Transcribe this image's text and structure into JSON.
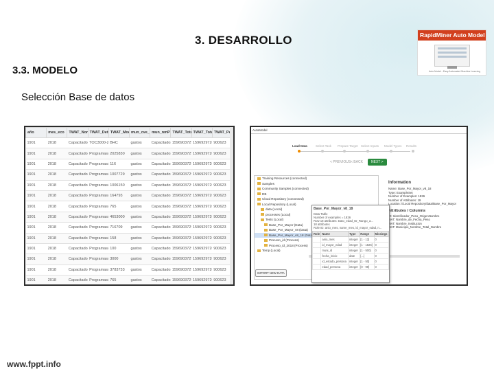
{
  "slide": {
    "title": "3. DESARROLLO",
    "subtitle": "3.3. MODELO",
    "caption": "Selección Base de datos",
    "footer": "www.fppt.info"
  },
  "logo": {
    "title": "RapidMiner Auto Model",
    "tagline": "Auto Model - Easy Automated Machine Learning"
  },
  "table_shot": {
    "columns": [
      "año",
      "mes_eco",
      "TWAT_Nombr...",
      "TWAT_Detalle",
      "TWAT_Mode",
      "mun_cve_Pl...",
      "mun_nmPlu...",
      "TWAT_Total...",
      "TWAT_Total...",
      "TWAT_Peros..."
    ],
    "rows": [
      [
        "1901",
        "2018",
        "Capacitados",
        "TOC3000-20...",
        "BHC",
        "gastos",
        "Capacitados",
        "1596903729",
        "1596929726",
        "900623"
      ],
      [
        "1901",
        "2018",
        "Capacitados",
        "Programas/t...",
        "2025830",
        "gastos",
        "Capacitados",
        "1596903729",
        "1596929726",
        "900623"
      ],
      [
        "1901",
        "2018",
        "Capacitados",
        "Programas/t...",
        "116",
        "gastos",
        "Capacitados",
        "1596903729",
        "1596929726",
        "900623"
      ],
      [
        "1901",
        "2018",
        "Capacitados",
        "Programas/t...",
        "1007729",
        "gastos",
        "Capacitados",
        "1596903729",
        "1596929726",
        "900623"
      ],
      [
        "1901",
        "2018",
        "Capacitados",
        "Programas/t...",
        "1006150",
        "gastos",
        "Capacitados",
        "1596903729",
        "1596929726",
        "900623"
      ],
      [
        "1901",
        "2018",
        "Capacitados",
        "Programas/t...",
        "164793",
        "gastos",
        "Capacitados",
        "1596903729",
        "1596929726",
        "900623"
      ],
      [
        "1901",
        "2018",
        "Capacitados",
        "Programas/t...",
        "765",
        "gastos",
        "Capacitados",
        "1596903729",
        "1596929726",
        "900623"
      ],
      [
        "1901",
        "2018",
        "Capacitados",
        "Programas/t...",
        "4653000",
        "gastos",
        "Capacitados",
        "1596903729",
        "1596929726",
        "900623"
      ],
      [
        "1901",
        "2018",
        "Capacitados",
        "Programas/t...",
        "716709",
        "gastos",
        "Capacitados",
        "1596903729",
        "1596929726",
        "900623"
      ],
      [
        "1901",
        "2018",
        "Capacitados",
        "Programas/t...",
        "158",
        "gastos",
        "Capacitados",
        "1596903729",
        "1596929726",
        "900623"
      ],
      [
        "1901",
        "2018",
        "Capacitados",
        "Programas/t...",
        "100",
        "gastos",
        "Capacitados",
        "1596903729",
        "1596929726",
        "900623"
      ],
      [
        "1901",
        "2018",
        "Capacitados",
        "Programas/t...",
        "3000",
        "gastos",
        "Capacitados",
        "1596903729",
        "1596929726",
        "900623"
      ],
      [
        "1901",
        "2018",
        "Capacitados",
        "Programas/t...",
        "3783733",
        "gastos",
        "Capacitados",
        "1596903729",
        "1596929726",
        "900623"
      ],
      [
        "1901",
        "2018",
        "Capacitados",
        "Programas/t...",
        "765",
        "gastos",
        "Capacitados",
        "1596903729",
        "1596929726",
        "900623"
      ]
    ]
  },
  "rm_shot": {
    "tab": "AutoModel",
    "steps": [
      "Load Data",
      "Select Task",
      "Prepare Target",
      "Select Inputs",
      "Model Types",
      "Results"
    ],
    "active_step": 0,
    "buttons": {
      "prev": "< PREVIOUS",
      "back": "< BACK",
      "next": "NEXT >"
    },
    "tree": [
      {
        "label": "Training Resources (connected)",
        "sel": false
      },
      {
        "label": "Samples",
        "sel": false
      },
      {
        "label": "Community Samples (connected)",
        "sel": false
      },
      {
        "label": "DB",
        "sel": false
      },
      {
        "label": "Cloud Repository (connected)",
        "sel": false
      },
      {
        "label": "Local Repository (Local)",
        "sel": false
      },
      {
        "label": "data (Local)",
        "sel": false
      },
      {
        "label": "processes (Local)",
        "sel": false
      },
      {
        "label": "Tests (Local)",
        "sel": false
      },
      {
        "label": "Base_Por_Mayor (Data)",
        "sel": false
      },
      {
        "label": "Base_Por_Mayor_v8 (Data)",
        "sel": false
      },
      {
        "label": "Base_Por_Mayor_v8_18 (Data)",
        "sel": true
      },
      {
        "label": "Proceso_id (Process)",
        "sel": false
      },
      {
        "label": "Proceso_id_2018 (Process)",
        "sel": false
      },
      {
        "label": "Temp (Local)",
        "sel": false
      }
    ],
    "load_button": "IMPORT NEW DATA",
    "info": {
      "header": "Information",
      "lines": [
        "Name: Base_Por_Mayor_v8_18",
        "Type: ExampleSet",
        "Number of Examples: 1826",
        "Number of Attributes: 19",
        "Location: //Local Repository/data/Base_Por_Mayor"
      ],
      "attrs_header": "Attributes / Columns",
      "attrs_lines": [
        "ID: Identificador_Peso_OrigenNombre",
        "MAT: Nombre_de_Fecha_Peso",
        "MAT: Nombre_Institucion",
        "MAT: Municipio_Nombre_Total_Nombre"
      ]
    },
    "popup": {
      "title": "Base_Por_Mayor_v8_18",
      "lines": [
        "Data Table",
        "Number of examples = 1826",
        "Row 18 attributes: Dato_edad_ID_Rango_a...",
        "18 attributes",
        "Role ID: anio_mes, name_mes, id_mayor_edad, n..."
      ],
      "columns": [
        "Role",
        "Name",
        "Type",
        "Range",
        "Missings"
      ],
      "rows": [
        [
          "",
          "anio_mes",
          "integer",
          "[1 - 12]",
          "0"
        ],
        [
          "",
          "id_mayor_edad",
          "integer",
          "[1 - 1826]",
          "0"
        ],
        [
          "",
          "muni_id",
          "integer",
          "[1 - 500]",
          "0"
        ],
        [
          "",
          "fecha_inicio",
          "date",
          "[...]",
          "0"
        ],
        [
          "",
          "id_estado_persona",
          "integer",
          "[1 - 50]",
          "0"
        ],
        [
          "",
          "edad_persona",
          "integer",
          "[0 - 99]",
          "0"
        ]
      ]
    }
  }
}
